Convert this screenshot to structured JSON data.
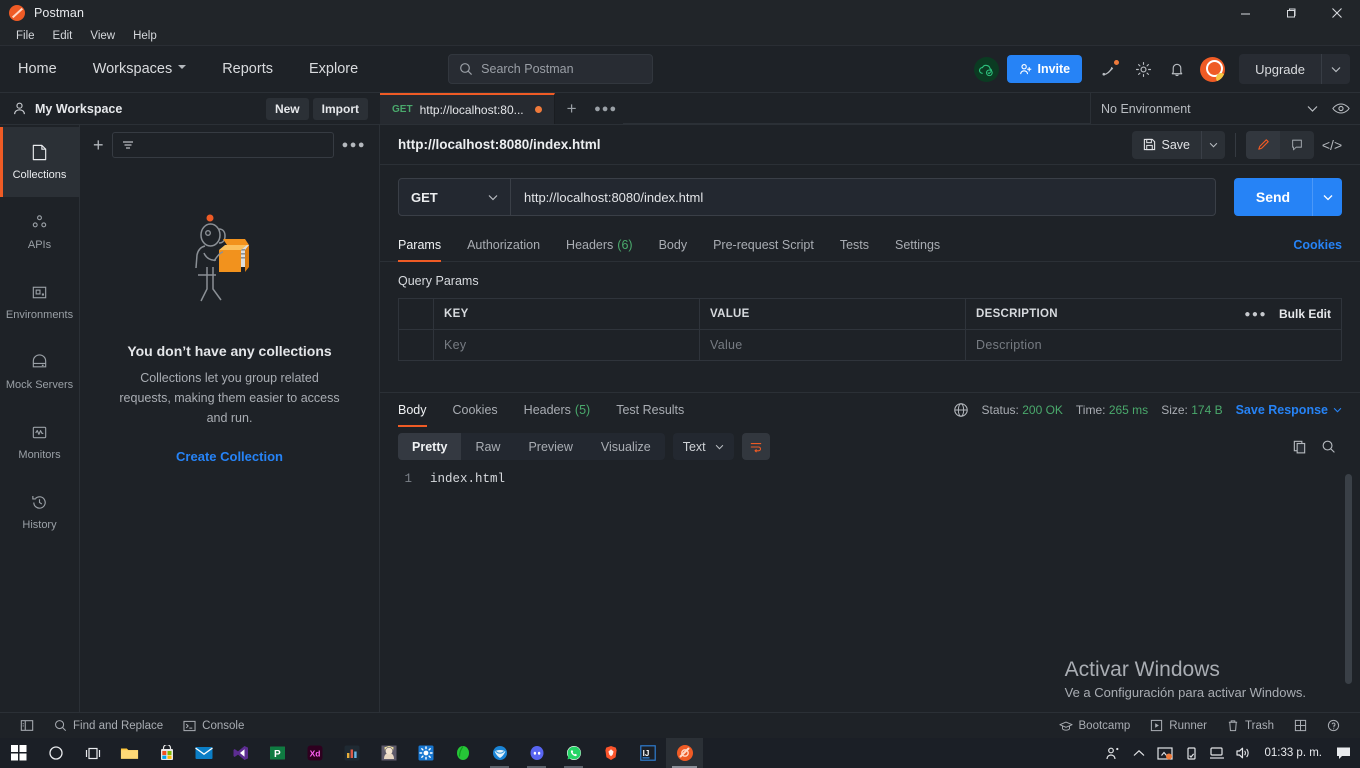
{
  "window": {
    "title": "Postman",
    "app_icon": "postman-logo-icon",
    "controls": {
      "minimize": "minimize-icon",
      "maximize": "maximize-icon",
      "close": "close-icon"
    }
  },
  "menubar": {
    "items": [
      "File",
      "Edit",
      "View",
      "Help"
    ]
  },
  "topnav": {
    "links": [
      {
        "label": "Home",
        "has_caret": false
      },
      {
        "label": "Workspaces",
        "has_caret": true
      },
      {
        "label": "Reports",
        "has_caret": false
      },
      {
        "label": "Explore",
        "has_caret": false
      }
    ],
    "search": {
      "placeholder": "Search Postman",
      "icon": "search-icon"
    },
    "sync_icon": "cloud-sync-icon",
    "invite_label": "Invite",
    "icons": [
      "satellite-icon",
      "gear-icon",
      "bell-icon"
    ],
    "upgrade_label": "Upgrade",
    "accent_blue": "#2683f6",
    "accent_orange": "#ef5b25"
  },
  "workspace": {
    "name": "My Workspace",
    "new_label": "New",
    "import_label": "Import"
  },
  "tabs": {
    "open": [
      {
        "method": "GET",
        "label": "http://localhost:80...",
        "unsaved": true,
        "active": true
      }
    ],
    "new_tab_icon": "plus-icon",
    "more_icon": "ellipsis-icon"
  },
  "environment": {
    "selected": "No Environment",
    "eye_icon": "eye-icon"
  },
  "rail": {
    "items": [
      {
        "label": "Collections",
        "icon": "collections-icon",
        "active": true
      },
      {
        "label": "APIs",
        "icon": "apis-icon",
        "active": false
      },
      {
        "label": "Environments",
        "icon": "environments-icon",
        "active": false
      },
      {
        "label": "Mock Servers",
        "icon": "mock-servers-icon",
        "active": false
      },
      {
        "label": "Monitors",
        "icon": "monitors-icon",
        "active": false
      },
      {
        "label": "History",
        "icon": "history-icon",
        "active": false
      }
    ]
  },
  "collections_panel": {
    "new_icon": "plus-icon",
    "filter_icon": "filter-icon",
    "more_icon": "ellipsis-icon",
    "empty_title": "You don’t have any collections",
    "empty_subtitle": "Collections let you group related requests, making them easier to access and run.",
    "create_link": "Create Collection",
    "illustration": "person-with-box-illustration"
  },
  "request": {
    "title": "http://localhost:8080/index.html",
    "save_label": "Save",
    "save_icon": "floppy-disk-icon",
    "edit_icon": "pencil-icon",
    "comment_icon": "comment-icon",
    "code_icon": "code-icon",
    "method": "GET",
    "url": "http://localhost:8080/index.html",
    "send_label": "Send",
    "tabs": [
      {
        "label": "Params",
        "count": "",
        "active": true
      },
      {
        "label": "Authorization",
        "count": "",
        "active": false
      },
      {
        "label": "Headers",
        "count": "(6)",
        "active": false
      },
      {
        "label": "Body",
        "count": "",
        "active": false
      },
      {
        "label": "Pre-request Script",
        "count": "",
        "active": false
      },
      {
        "label": "Tests",
        "count": "",
        "active": false
      },
      {
        "label": "Settings",
        "count": "",
        "active": false
      }
    ],
    "cookies_link": "Cookies",
    "query_params_label": "Query Params",
    "table": {
      "headers": [
        "KEY",
        "VALUE",
        "DESCRIPTION"
      ],
      "more_icon": "ellipsis-icon",
      "bulk_edit_label": "Bulk Edit",
      "rows": [
        {
          "key_placeholder": "Key",
          "value_placeholder": "Value",
          "description_placeholder": "Description"
        }
      ]
    }
  },
  "response": {
    "tabs": [
      {
        "label": "Body",
        "count": "",
        "active": true
      },
      {
        "label": "Cookies",
        "count": "",
        "active": false
      },
      {
        "label": "Headers",
        "count": "(5)",
        "active": false
      },
      {
        "label": "Test Results",
        "count": "",
        "active": false
      }
    ],
    "globe_icon": "globe-icon",
    "status_label": "Status:",
    "status_value": "200 OK",
    "time_label": "Time:",
    "time_value": "265 ms",
    "size_label": "Size:",
    "size_value": "174 B",
    "save_response_label": "Save Response",
    "view_modes": [
      {
        "label": "Pretty",
        "active": true
      },
      {
        "label": "Raw",
        "active": false
      },
      {
        "label": "Preview",
        "active": false
      },
      {
        "label": "Visualize",
        "active": false
      }
    ],
    "format": "Text",
    "wrap_icon": "word-wrap-icon",
    "copy_icon": "copy-icon",
    "search_icon": "search-icon",
    "body_lines": [
      {
        "number": "1",
        "text": "index.html"
      }
    ]
  },
  "watermark": {
    "line1": "Activar Windows",
    "line2": "Ve a Configuración para activar Windows."
  },
  "footer": {
    "left": [
      {
        "label": "",
        "icon": "sidebar-toggle-icon"
      },
      {
        "label": "Find and Replace",
        "icon": "search-icon"
      },
      {
        "label": "Console",
        "icon": "console-icon"
      }
    ],
    "right": [
      {
        "label": "Bootcamp",
        "icon": "bootcamp-icon"
      },
      {
        "label": "Runner",
        "icon": "runner-icon"
      },
      {
        "label": "Trash",
        "icon": "trash-icon"
      },
      {
        "label": "",
        "icon": "layout-icon"
      },
      {
        "label": "",
        "icon": "help-icon"
      }
    ]
  },
  "taskbar": {
    "items": [
      {
        "name": "start-button",
        "icon": "windows-logo-icon"
      },
      {
        "name": "search-button",
        "icon": "search-circle-icon"
      },
      {
        "name": "task-view-button",
        "icon": "task-view-icon"
      },
      {
        "name": "file-explorer",
        "icon": "folder-icon"
      },
      {
        "name": "microsoft-store",
        "icon": "store-icon"
      },
      {
        "name": "mail",
        "icon": "mail-icon"
      },
      {
        "name": "visual-studio",
        "icon": "visual-studio-icon"
      },
      {
        "name": "powerpoint",
        "icon": "powerpoint-icon"
      },
      {
        "name": "adobe-xd",
        "icon": "adobe-xd-icon"
      },
      {
        "name": "analytics-app",
        "icon": "bar-chart-icon"
      },
      {
        "name": "anime-app",
        "icon": "avatar-icon"
      },
      {
        "name": "settings-app",
        "icon": "blue-gear-icon"
      },
      {
        "name": "green-app",
        "icon": "leaf-icon"
      },
      {
        "name": "thunderbird",
        "icon": "thunderbird-icon"
      },
      {
        "name": "discord",
        "icon": "discord-icon"
      },
      {
        "name": "whatsapp",
        "icon": "whatsapp-icon"
      },
      {
        "name": "brave-browser",
        "icon": "brave-icon"
      },
      {
        "name": "intellij-idea",
        "icon": "intellij-icon"
      },
      {
        "name": "postman-taskbar",
        "icon": "postman-logo-icon"
      }
    ],
    "tray": [
      "people-icon",
      "show-hidden-icons-icon",
      "screen-icon",
      "usb-icon",
      "network-icon",
      "volume-icon"
    ],
    "clock": "01:33 p. m.",
    "notifications_icon": "action-center-icon"
  }
}
